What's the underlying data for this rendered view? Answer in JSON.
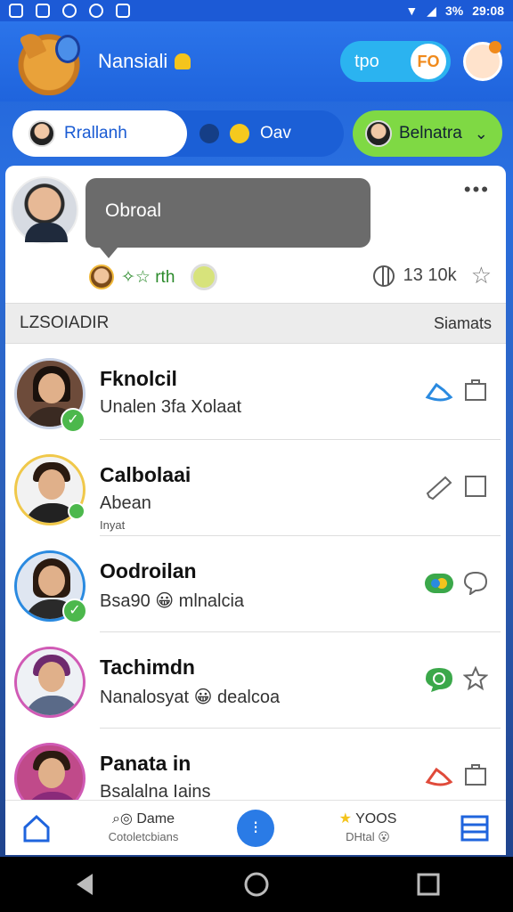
{
  "status_bar": {
    "battery": "3%",
    "time": "29:08"
  },
  "header": {
    "app_name": "Nansiali",
    "toggle_label": "tpo",
    "toggle_knob": "FO"
  },
  "chips": {
    "chip1_label": "Rrallanh",
    "chip2_label": "Oav",
    "chip3_label": "Belnatra"
  },
  "post": {
    "bubble_text": "Obroal",
    "meta_text": "✧☆ rth",
    "stats_text": "13 10k",
    "more": "•••"
  },
  "section": {
    "title": "LZSOIADIR",
    "right": "Siamats"
  },
  "contacts": [
    {
      "name": "Fknolcil",
      "sub": "Unalen 3fa Xolaat",
      "tiny": "",
      "act1": "link",
      "act2": "bag"
    },
    {
      "name": "Calbolaai",
      "sub": "Abean",
      "tiny": "Inyat",
      "act1": "pen",
      "act2": "square"
    },
    {
      "name": "Oodroilan",
      "sub": "Bsa90 😀 mlnalcia",
      "tiny": "",
      "act1": "badge",
      "act2": "chat"
    },
    {
      "name": "Tachimdn",
      "sub": "Nanalosyat 😀 dealcoa",
      "tiny": "",
      "act1": "chat-green",
      "act2": "star"
    },
    {
      "name": "Panata in",
      "sub": "Bsalalna Iains",
      "tiny": "",
      "act1": "link-red",
      "act2": "bag"
    }
  ],
  "bottom_nav": {
    "slot1_top": "Dame",
    "slot1_bottom": "Cotoletcbians",
    "slot2_top": "YOOS",
    "slot2_bottom": "DHtal"
  },
  "colors": {
    "primary": "#1f64dd",
    "accent_green": "#7fd944",
    "check_green": "#4cb84c"
  }
}
